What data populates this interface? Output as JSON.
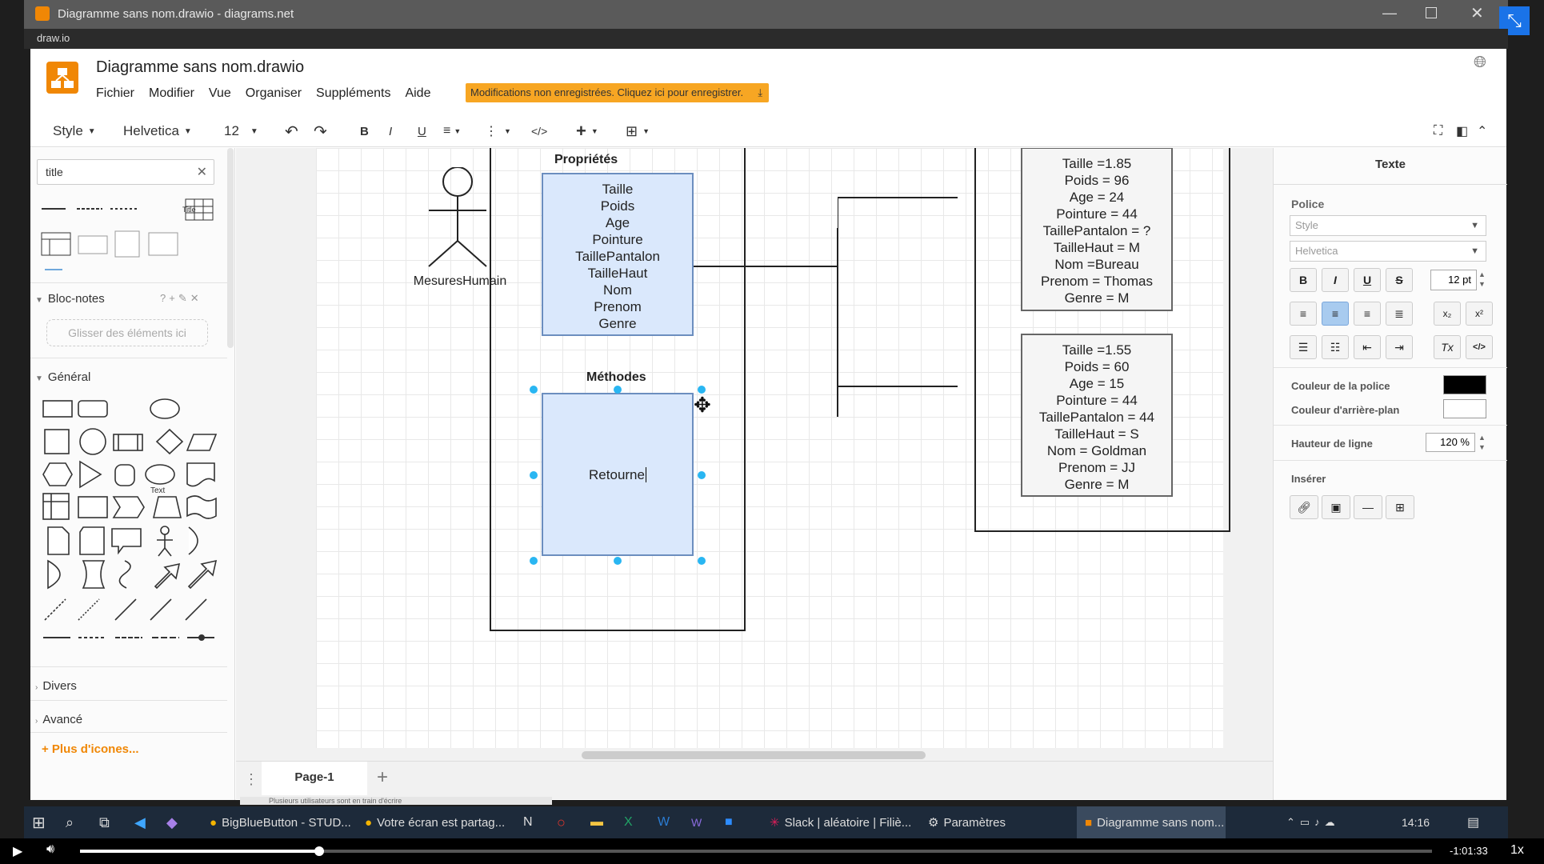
{
  "window": {
    "title": "Diagramme sans nom.drawio - diagrams.net",
    "app_name": "draw.io"
  },
  "app": {
    "file_title": "Diagramme sans nom.drawio",
    "menu": [
      "Fichier",
      "Modifier",
      "Vue",
      "Organiser",
      "Suppléments",
      "Aide"
    ],
    "unsaved_banner": "Modifications non enregistrées. Cliquez ici pour enregistrer."
  },
  "toolbar": {
    "style": "Style",
    "font": "Helvetica",
    "size": "12"
  },
  "sidebar": {
    "search_value": "title",
    "scratchpad_title": "Bloc-notes",
    "scratchpad_drop": "Glisser des éléments ici",
    "general_title": "Général",
    "text_shape": "Text",
    "title_shape": "Title",
    "divers": "Divers",
    "avance": "Avancé",
    "more_shapes": "+ Plus d'icones..."
  },
  "diagram": {
    "actor_label": "MesuresHumain",
    "props_title": "Propriétés",
    "props": [
      "Taille",
      "Poids",
      "Age",
      "Pointure",
      "TaillePantalon",
      "TailleHaut",
      "Nom",
      "Prenom",
      "Genre"
    ],
    "methods_title": "Méthodes",
    "methods_text": "Retourne",
    "obj1": [
      "Taille =1.85",
      "Poids = 96",
      "Age = 24",
      "Pointure = 44",
      "TaillePantalon = ?",
      "TailleHaut = M",
      "Nom =Bureau",
      "Prenom = Thomas",
      "Genre = M"
    ],
    "obj2": [
      "Taille =1.55",
      "Poids = 60",
      "Age = 15",
      "Pointure = 44",
      "TaillePantalon = 44",
      "TailleHaut = S",
      "Nom = Goldman",
      "Prenom = JJ",
      "Genre = M"
    ]
  },
  "page_tab": {
    "label": "Page-1"
  },
  "format_panel": {
    "title": "Texte",
    "police": "Police",
    "style_select": "Style",
    "font_select": "Helvetica",
    "font_size": "12 pt",
    "font_color_label": "Couleur de la police",
    "bg_color_label": "Couleur d'arrière-plan",
    "line_height_label": "Hauteur de ligne",
    "line_height": "120 %",
    "insert_label": "Insérer"
  },
  "taskbar": {
    "items": [
      "BigBlueButton - STUD...",
      "Votre écran est partag...",
      "Slack | aléatoire | Filiè...",
      "Paramètres",
      "Diagramme sans nom..."
    ],
    "time": "14:16",
    "overlay_text": "Plusieurs utilisateurs sont en train d'écrire"
  },
  "player": {
    "remaining": "-1:01:33",
    "speed": "1x",
    "progress": 0.177
  },
  "colors": {
    "accent": "#f08705",
    "selection": "#29b6f2",
    "shape_fill": "#dae8fc",
    "banner": "#f7a623"
  }
}
